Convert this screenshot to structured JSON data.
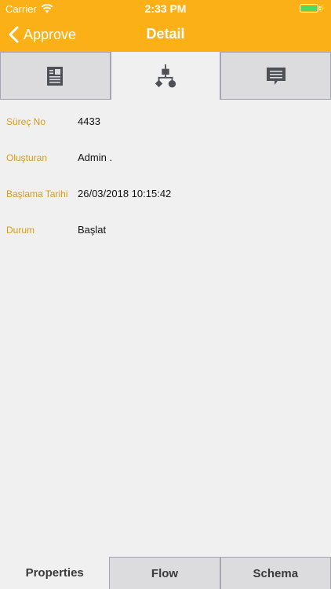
{
  "status_bar": {
    "carrier": "Carrier",
    "time": "2:33 PM"
  },
  "nav": {
    "back_label": "Approve",
    "title": "Detail"
  },
  "top_tabs": [
    {
      "icon": "document-icon",
      "active": false
    },
    {
      "icon": "flow-diagram-icon",
      "active": true
    },
    {
      "icon": "comment-icon",
      "active": false
    }
  ],
  "properties": [
    {
      "label": "Süreç No",
      "value": "4433"
    },
    {
      "label": "Oluşturan",
      "value": "Admin ."
    },
    {
      "label": "Başlama Tarihi",
      "value": "26/03/2018 10:15:42"
    },
    {
      "label": "Durum",
      "value": "Başlat"
    }
  ],
  "bottom_tabs": [
    {
      "label": "Properties",
      "active": true
    },
    {
      "label": "Flow",
      "active": false
    },
    {
      "label": "Schema",
      "active": false
    }
  ],
  "colors": {
    "accent": "#fcb018",
    "label": "#d99a18",
    "icon": "#4d5056",
    "battery": "#4cd964"
  }
}
